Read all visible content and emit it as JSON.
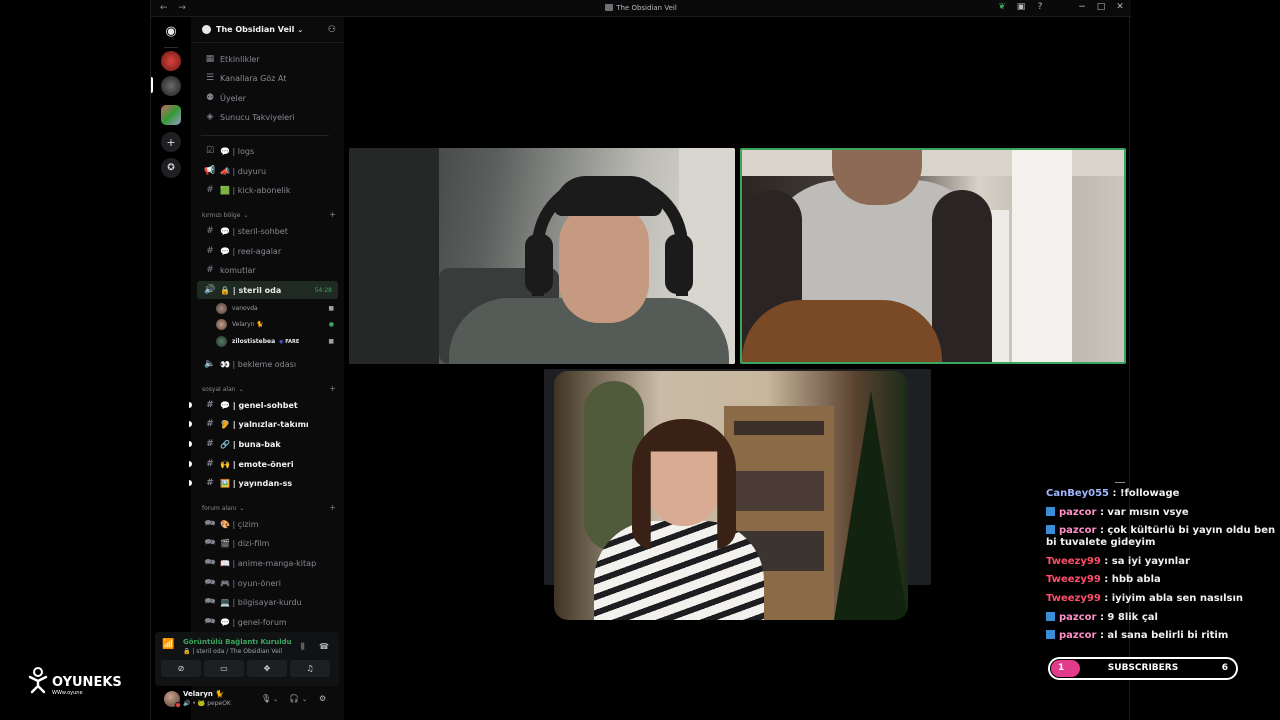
{
  "window": {
    "title": "The Obsidian Veil",
    "nav": "← →"
  },
  "server": {
    "name": "The Obsidian Veil"
  },
  "sidebar": {
    "top": [
      {
        "icon": "calendar-icon",
        "label": "Etkinlikler"
      },
      {
        "icon": "browse-icon",
        "label": "Kanallara Göz At"
      },
      {
        "icon": "members-icon",
        "label": "Üyeler"
      },
      {
        "icon": "boost-icon",
        "label": "Sunucu Takviyeleri"
      }
    ],
    "channels_a": [
      {
        "label": "💬 | logs"
      },
      {
        "label": "📣 | duyuru"
      },
      {
        "label": "🟩 | kick-abonelik"
      }
    ],
    "cat1": "kırmızı bölge",
    "channels_b": [
      {
        "label": "💬 | steril-sohbet"
      },
      {
        "label": "💬 | reel-agalar"
      },
      {
        "label": "komutlar"
      }
    ],
    "active_voice": {
      "label": "🔒 | steril oda",
      "timer": "54:28"
    },
    "voice_users": [
      {
        "name": "vanovda"
      },
      {
        "name": "Velaryn 🐈"
      },
      {
        "name": "zilostistebea",
        "badge": "FARE"
      }
    ],
    "waiting": "👀 | bekleme odası",
    "cat2": "sosyal alan",
    "social": [
      {
        "label": "💬 | genel-sohbet"
      },
      {
        "label": "🦻 | yalnızlar-takımı"
      },
      {
        "label": "🔗 | buna-bak"
      },
      {
        "label": "🙌 | emote-öneri"
      },
      {
        "label": "🖼️ | yayından-ss"
      }
    ],
    "cat3": "forum alanı",
    "forum": [
      {
        "label": "🎨 | çizim"
      },
      {
        "label": "🎬 | dizi-film"
      },
      {
        "label": "📖 | anime-manga-kitap"
      },
      {
        "label": "🎮 | oyun-öneri"
      },
      {
        "label": "💻 | bilgisayar-kurdu"
      },
      {
        "label": "💬 | genel-forum"
      }
    ]
  },
  "voice_panel": {
    "status": "Görüntülü Bağlantı Kuruldu",
    "sub": "🔒 | steril oda / The Obsidian Veil"
  },
  "user_panel": {
    "name": "Velaryn 🐈",
    "status": "🔊 • 🐸 pepeOK"
  },
  "chat": [
    {
      "user": "CanBey055",
      "color": "#9fb8ff",
      "twitch": false,
      "text": ": !followage"
    },
    {
      "user": "pazcor",
      "color": "#ff8fc8",
      "twitch": true,
      "text": ": var mısın vsye"
    },
    {
      "user": "pazcor",
      "color": "#ff8fc8",
      "twitch": true,
      "text": ": çok kültürlü bi yayın oldu ben bi tuvalete gideyim"
    },
    {
      "user": "Tweezy99",
      "color": "#ff4d6a",
      "twitch": false,
      "text": ": sa iyi yayınlar"
    },
    {
      "user": "Tweezy99",
      "color": "#ff4d6a",
      "twitch": false,
      "text": ": hbb abla"
    },
    {
      "user": "Tweezy99",
      "color": "#ff4d6a",
      "twitch": false,
      "text": ": iyiyim abla sen nasılsın"
    },
    {
      "user": "pazcor",
      "color": "#ff8fc8",
      "twitch": true,
      "text": ": 9 8lik çal"
    },
    {
      "user": "pazcor",
      "color": "#ff8fc8",
      "twitch": true,
      "text": ": al sana belirli bi ritim"
    }
  ],
  "subs": {
    "current": "1",
    "label": "SUBSCRIBERS",
    "goal": "6",
    "progress": 0.16
  },
  "brand": {
    "name": "OYUNEKS",
    "sub": "WWw.oyune"
  },
  "colors": {
    "accent": "#3ba55d",
    "sub_fill": "#e23b8c"
  }
}
